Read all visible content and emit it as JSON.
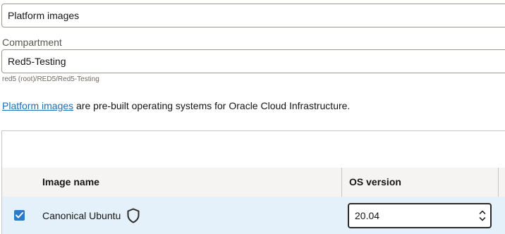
{
  "image_source": {
    "value": "Platform images"
  },
  "compartment": {
    "label": "Compartment",
    "value": "Red5-Testing",
    "path": "red5 (root)/RED5/Red5-Testing"
  },
  "description": {
    "link_text": "Platform images",
    "rest_text": " are pre-built operating systems for Oracle Cloud Infrastructure."
  },
  "table": {
    "columns": [
      "Image name",
      "OS version"
    ],
    "rows": [
      {
        "selected": true,
        "image_name": "Canonical Ubuntu",
        "icon": "shield-icon",
        "os_version": "20.04"
      }
    ]
  },
  "colors": {
    "link": "#1a6fb8",
    "selected_row": "#e4f1fb",
    "checkbox": "#2a7ac6"
  }
}
